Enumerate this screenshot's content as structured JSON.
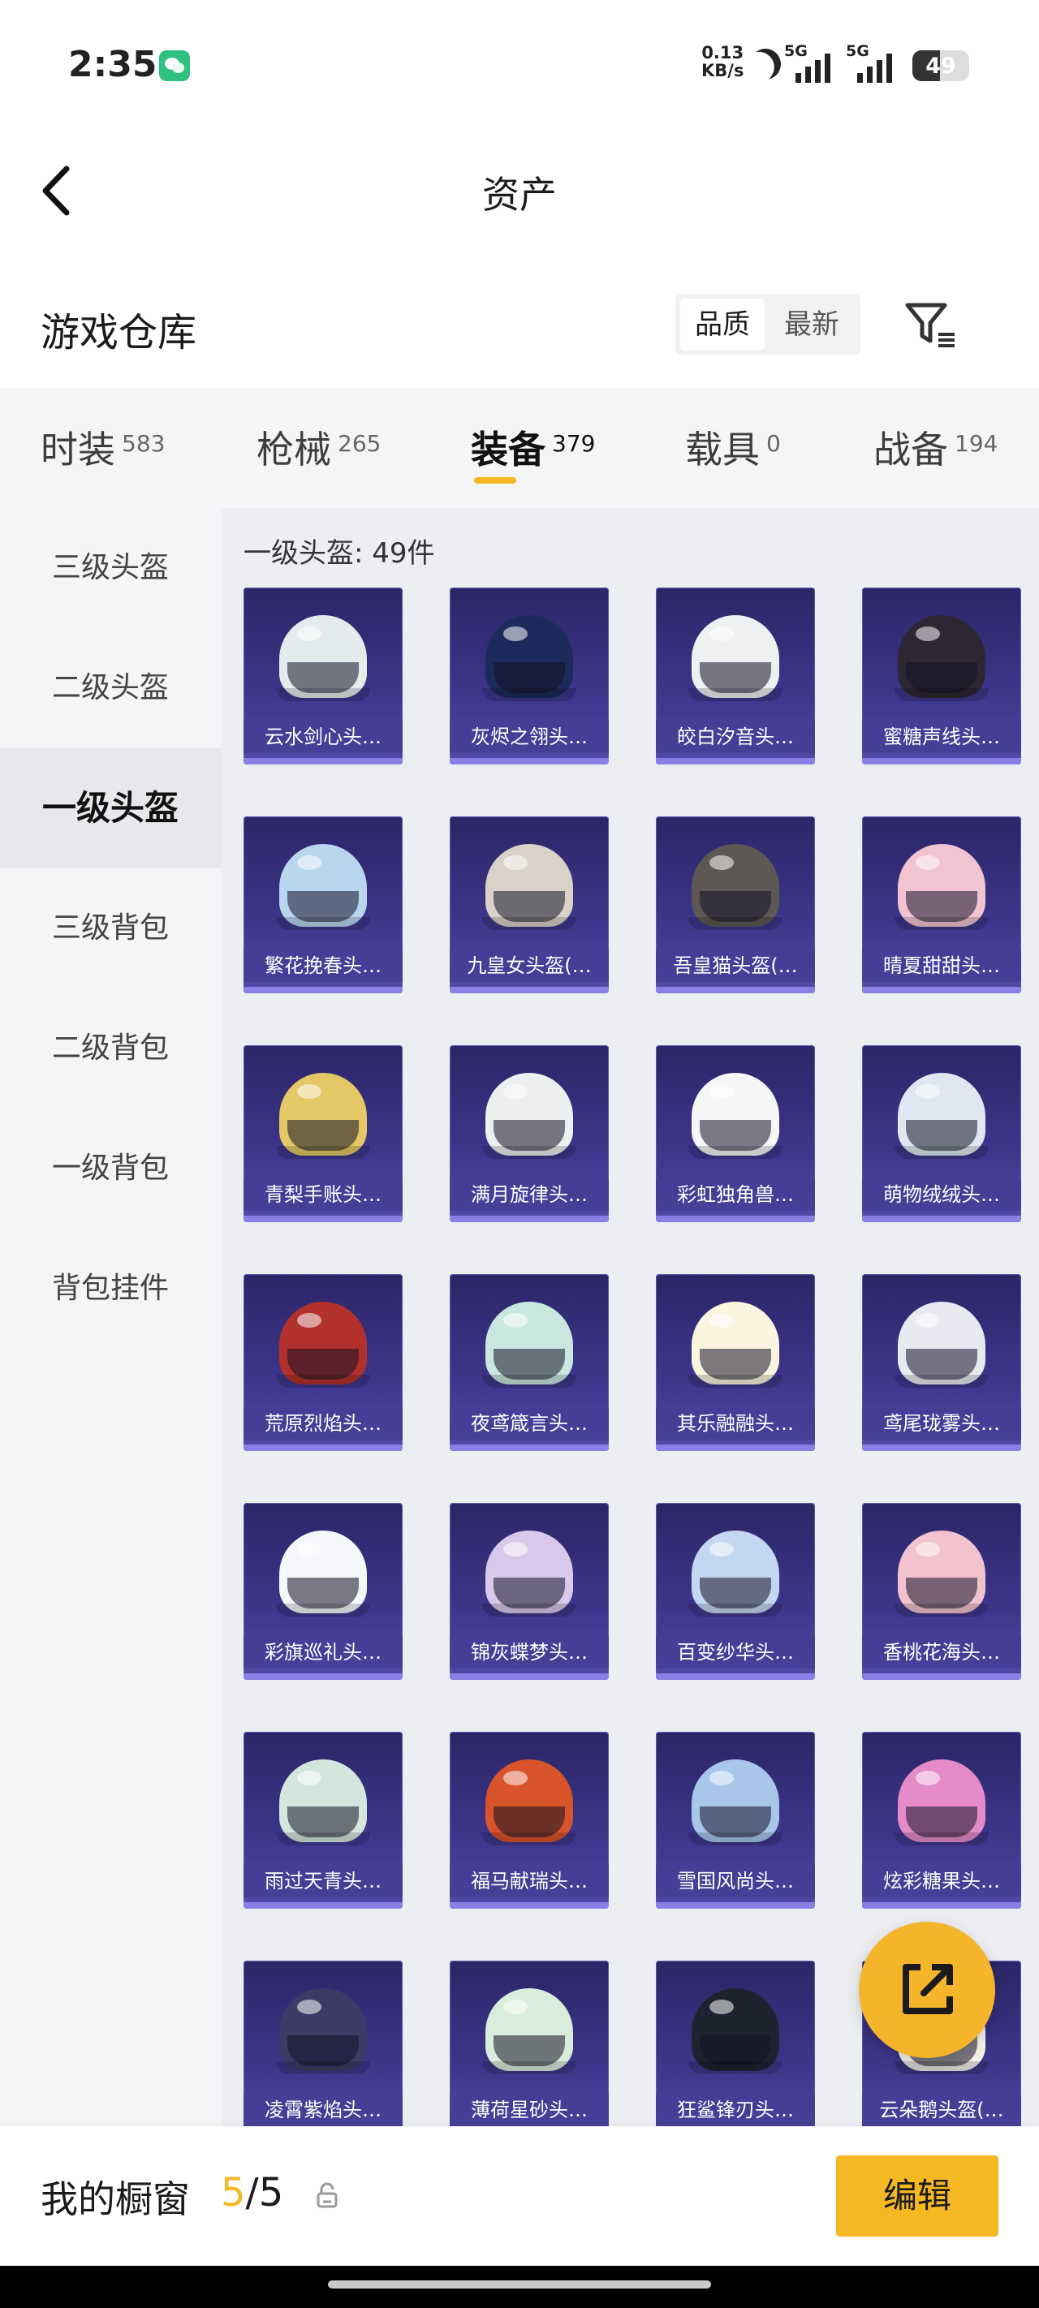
{
  "status_bar": {
    "time": "2:35",
    "net_speed_value": "0.13",
    "net_speed_unit": "KB/s",
    "signal_1": "5G",
    "signal_2": "5G",
    "battery": "49",
    "battery_level_percent": 49
  },
  "header": {
    "title": "资产"
  },
  "warehouse": {
    "title": "游戏仓库",
    "sort_options": [
      "品质",
      "最新"
    ],
    "active_sort": "品质"
  },
  "tabs": [
    {
      "label": "时装",
      "count": "583"
    },
    {
      "label": "枪械",
      "count": "265"
    },
    {
      "label": "装备",
      "count": "379"
    },
    {
      "label": "载具",
      "count": "0"
    },
    {
      "label": "战备",
      "count": "194"
    }
  ],
  "active_tab": "装备",
  "sidebar": {
    "items": [
      {
        "label": "三级头盔"
      },
      {
        "label": "二级头盔"
      },
      {
        "label": "一级头盔"
      },
      {
        "label": "三级背包"
      },
      {
        "label": "二级背包"
      },
      {
        "label": "一级背包"
      },
      {
        "label": "背包挂件"
      }
    ],
    "active": "一级头盔"
  },
  "content": {
    "section_heading": "一级头盔: 49件",
    "items": [
      {
        "name": "云水剑心头…",
        "color": "#e4ebec"
      },
      {
        "name": "灰烬之翎头…",
        "color": "#1d2a5c"
      },
      {
        "name": "皎白汐音头…",
        "color": "#eef0f2"
      },
      {
        "name": "蜜糖声线头…",
        "color": "#2c2733"
      },
      {
        "name": "繁花挽春头…",
        "color": "#b9d6ef"
      },
      {
        "name": "九皇女头盔(…",
        "color": "#d9d2c8"
      },
      {
        "name": "吾皇猫头盔(…",
        "color": "#5d5853"
      },
      {
        "name": "晴夏甜甜头…",
        "color": "#f2c4d2"
      },
      {
        "name": "青梨手账头…",
        "color": "#e3c865"
      },
      {
        "name": "满月旋律头…",
        "color": "#eceef0"
      },
      {
        "name": "彩虹独角兽…",
        "color": "#f6f6f8"
      },
      {
        "name": "萌物绒绒头…",
        "color": "#dfe8f2"
      },
      {
        "name": "荒原烈焰头…",
        "color": "#b3312c"
      },
      {
        "name": "夜鸢箴言头…",
        "color": "#c9e6df"
      },
      {
        "name": "其乐融融头…",
        "color": "#fbf4df"
      },
      {
        "name": "鸢尾珑雾头…",
        "color": "#e8e9f1"
      },
      {
        "name": "彩旗巡礼头…",
        "color": "#f6f7fb"
      },
      {
        "name": "锦灰蝶梦头…",
        "color": "#d8c9ea"
      },
      {
        "name": "百变纱华头…",
        "color": "#c4d7f0"
      },
      {
        "name": "香桃花海头…",
        "color": "#f2c2ce"
      },
      {
        "name": "雨过天青头…",
        "color": "#d3e6dd"
      },
      {
        "name": "福马献瑞头…",
        "color": "#d9542b"
      },
      {
        "name": "雪国风尚头…",
        "color": "#a8c6ea"
      },
      {
        "name": "炫彩糖果头…",
        "color": "#e58cc8"
      },
      {
        "name": "凌霄紫焰头…",
        "color": "#3d3a66"
      },
      {
        "name": "薄荷星砂头…",
        "color": "#d9eddc"
      },
      {
        "name": "狂鲨锋刃头…",
        "color": "#1e2330"
      },
      {
        "name": "云朵鹅头盔(…",
        "color": "#f5f2e9"
      }
    ]
  },
  "bottom_bar": {
    "showcase_label": "我的橱窗",
    "current": "5",
    "separator": "/",
    "max": "5",
    "edit_label": "编辑"
  },
  "colors": {
    "accent": "#f5b722",
    "card_bg": "#3d358a"
  }
}
